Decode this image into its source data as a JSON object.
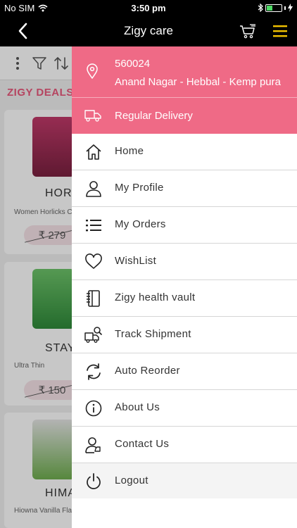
{
  "status_bar": {
    "carrier": "No SIM",
    "time": "3:50 pm",
    "colors": {
      "battery": "#4cd964"
    }
  },
  "nav": {
    "title": "Zigy care",
    "icons": [
      "back-arrow-icon",
      "cart-icon",
      "hamburger-menu-icon"
    ],
    "colors": {
      "menu_accent": "#f2c200"
    }
  },
  "background": {
    "section_title": "ZIGY DEALS O",
    "products": [
      {
        "name": "HOR",
        "description": "Women Horlicks C",
        "price": "₹ 279"
      },
      {
        "name": "STAY",
        "description": "Ultra Thin ",
        "price": "₹ 150"
      },
      {
        "name": "HIMA",
        "description": "Hiowna Vanilla Fla",
        "price": ""
      }
    ]
  },
  "drawer": {
    "pincode": "560024",
    "area": "Anand Nagar - Hebbal - Kemp pura",
    "delivery": "Regular Delivery",
    "colors": {
      "header": "#ef6a86"
    },
    "items": [
      {
        "label": "Home",
        "icon": "home-icon"
      },
      {
        "label": "My Profile",
        "icon": "profile-icon"
      },
      {
        "label": "My Orders",
        "icon": "list-icon"
      },
      {
        "label": "WishList",
        "icon": "heart-icon"
      },
      {
        "label": "Zigy health vault",
        "icon": "notebook-icon"
      },
      {
        "label": "Track Shipment",
        "icon": "truck-search-icon"
      },
      {
        "label": "Auto Reorder",
        "icon": "refresh-icon"
      },
      {
        "label": "About Us",
        "icon": "info-icon"
      },
      {
        "label": "Contact Us",
        "icon": "contact-icon"
      },
      {
        "label": "Logout",
        "icon": "power-icon"
      }
    ]
  }
}
